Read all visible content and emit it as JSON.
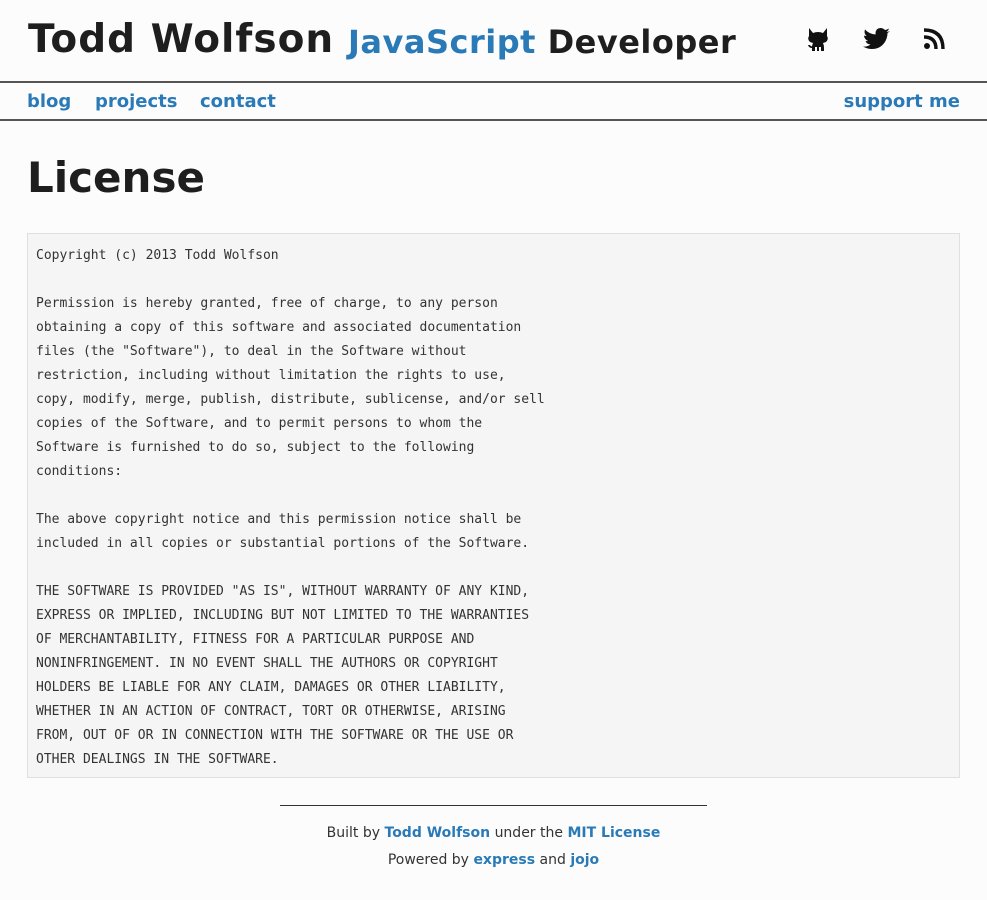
{
  "header": {
    "site_name": "Todd Wolfson",
    "tagline_accent": "JavaScript",
    "tagline_rest": "Developer",
    "social": [
      {
        "icon": "github-icon",
        "label": "GitHub"
      },
      {
        "icon": "twitter-icon",
        "label": "Twitter"
      },
      {
        "icon": "rss-icon",
        "label": "RSS"
      }
    ]
  },
  "nav": {
    "blog": "blog",
    "projects": "projects",
    "contact": "contact",
    "support": "support me"
  },
  "main": {
    "title": "License",
    "license_text": "Copyright (c) 2013 Todd Wolfson\n\nPermission is hereby granted, free of charge, to any person\nobtaining a copy of this software and associated documentation\nfiles (the \"Software\"), to deal in the Software without\nrestriction, including without limitation the rights to use,\ncopy, modify, merge, publish, distribute, sublicense, and/or sell\ncopies of the Software, and to permit persons to whom the\nSoftware is furnished to do so, subject to the following\nconditions:\n\nThe above copyright notice and this permission notice shall be\nincluded in all copies or substantial portions of the Software.\n\nTHE SOFTWARE IS PROVIDED \"AS IS\", WITHOUT WARRANTY OF ANY KIND,\nEXPRESS OR IMPLIED, INCLUDING BUT NOT LIMITED TO THE WARRANTIES\nOF MERCHANTABILITY, FITNESS FOR A PARTICULAR PURPOSE AND\nNONINFRINGEMENT. IN NO EVENT SHALL THE AUTHORS OR COPYRIGHT\nHOLDERS BE LIABLE FOR ANY CLAIM, DAMAGES OR OTHER LIABILITY,\nWHETHER IN AN ACTION OF CONTRACT, TORT OR OTHERWISE, ARISING\nFROM, OUT OF OR IN CONNECTION WITH THE SOFTWARE OR THE USE OR\nOTHER DEALINGS IN THE SOFTWARE."
  },
  "footer": {
    "built_by_prefix": "Built by",
    "author_link": "Todd Wolfson",
    "under_the": "under the",
    "license_link": "MIT License",
    "powered_by_prefix": "Powered by",
    "express_link": "express",
    "and": "and",
    "jojo_link": "jojo"
  },
  "colors": {
    "accent": "#2a7ab8",
    "text": "#1e1e1e",
    "background": "#fcfcfc",
    "code_background": "#f5f5f5"
  }
}
